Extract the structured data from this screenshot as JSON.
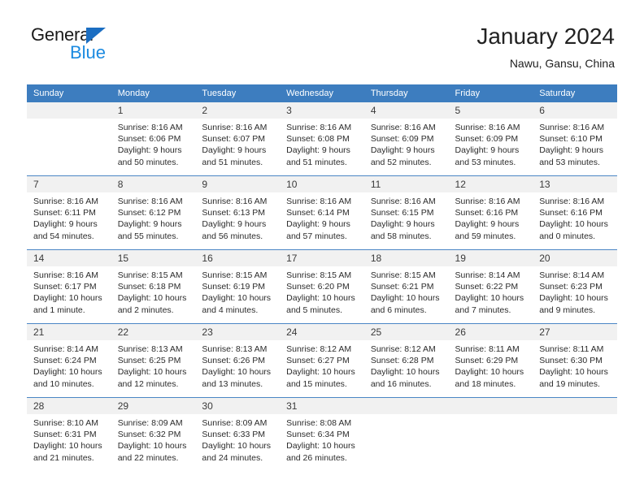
{
  "brand": {
    "name_top": "General",
    "name_bottom": "Blue",
    "accent_color": "#1b8ae0",
    "triangle_color": "#1b6ec2"
  },
  "header": {
    "title": "January 2024",
    "subtitle": "Nawu, Gansu, China"
  },
  "theme": {
    "header_bg": "#3d7dbf",
    "daynum_bg": "#f1f1f1",
    "grid_line": "#4a86c5"
  },
  "weekday_headers": [
    "Sunday",
    "Monday",
    "Tuesday",
    "Wednesday",
    "Thursday",
    "Friday",
    "Saturday"
  ],
  "weeks": [
    [
      {
        "day": "",
        "sunrise": "",
        "sunset": "",
        "daylight1": "",
        "daylight2": "",
        "empty": true
      },
      {
        "day": "1",
        "sunrise": "Sunrise: 8:16 AM",
        "sunset": "Sunset: 6:06 PM",
        "daylight1": "Daylight: 9 hours",
        "daylight2": "and 50 minutes."
      },
      {
        "day": "2",
        "sunrise": "Sunrise: 8:16 AM",
        "sunset": "Sunset: 6:07 PM",
        "daylight1": "Daylight: 9 hours",
        "daylight2": "and 51 minutes."
      },
      {
        "day": "3",
        "sunrise": "Sunrise: 8:16 AM",
        "sunset": "Sunset: 6:08 PM",
        "daylight1": "Daylight: 9 hours",
        "daylight2": "and 51 minutes."
      },
      {
        "day": "4",
        "sunrise": "Sunrise: 8:16 AM",
        "sunset": "Sunset: 6:09 PM",
        "daylight1": "Daylight: 9 hours",
        "daylight2": "and 52 minutes."
      },
      {
        "day": "5",
        "sunrise": "Sunrise: 8:16 AM",
        "sunset": "Sunset: 6:09 PM",
        "daylight1": "Daylight: 9 hours",
        "daylight2": "and 53 minutes."
      },
      {
        "day": "6",
        "sunrise": "Sunrise: 8:16 AM",
        "sunset": "Sunset: 6:10 PM",
        "daylight1": "Daylight: 9 hours",
        "daylight2": "and 53 minutes."
      }
    ],
    [
      {
        "day": "7",
        "sunrise": "Sunrise: 8:16 AM",
        "sunset": "Sunset: 6:11 PM",
        "daylight1": "Daylight: 9 hours",
        "daylight2": "and 54 minutes."
      },
      {
        "day": "8",
        "sunrise": "Sunrise: 8:16 AM",
        "sunset": "Sunset: 6:12 PM",
        "daylight1": "Daylight: 9 hours",
        "daylight2": "and 55 minutes."
      },
      {
        "day": "9",
        "sunrise": "Sunrise: 8:16 AM",
        "sunset": "Sunset: 6:13 PM",
        "daylight1": "Daylight: 9 hours",
        "daylight2": "and 56 minutes."
      },
      {
        "day": "10",
        "sunrise": "Sunrise: 8:16 AM",
        "sunset": "Sunset: 6:14 PM",
        "daylight1": "Daylight: 9 hours",
        "daylight2": "and 57 minutes."
      },
      {
        "day": "11",
        "sunrise": "Sunrise: 8:16 AM",
        "sunset": "Sunset: 6:15 PM",
        "daylight1": "Daylight: 9 hours",
        "daylight2": "and 58 minutes."
      },
      {
        "day": "12",
        "sunrise": "Sunrise: 8:16 AM",
        "sunset": "Sunset: 6:16 PM",
        "daylight1": "Daylight: 9 hours",
        "daylight2": "and 59 minutes."
      },
      {
        "day": "13",
        "sunrise": "Sunrise: 8:16 AM",
        "sunset": "Sunset: 6:16 PM",
        "daylight1": "Daylight: 10 hours",
        "daylight2": "and 0 minutes."
      }
    ],
    [
      {
        "day": "14",
        "sunrise": "Sunrise: 8:16 AM",
        "sunset": "Sunset: 6:17 PM",
        "daylight1": "Daylight: 10 hours",
        "daylight2": "and 1 minute."
      },
      {
        "day": "15",
        "sunrise": "Sunrise: 8:15 AM",
        "sunset": "Sunset: 6:18 PM",
        "daylight1": "Daylight: 10 hours",
        "daylight2": "and 2 minutes."
      },
      {
        "day": "16",
        "sunrise": "Sunrise: 8:15 AM",
        "sunset": "Sunset: 6:19 PM",
        "daylight1": "Daylight: 10 hours",
        "daylight2": "and 4 minutes."
      },
      {
        "day": "17",
        "sunrise": "Sunrise: 8:15 AM",
        "sunset": "Sunset: 6:20 PM",
        "daylight1": "Daylight: 10 hours",
        "daylight2": "and 5 minutes."
      },
      {
        "day": "18",
        "sunrise": "Sunrise: 8:15 AM",
        "sunset": "Sunset: 6:21 PM",
        "daylight1": "Daylight: 10 hours",
        "daylight2": "and 6 minutes."
      },
      {
        "day": "19",
        "sunrise": "Sunrise: 8:14 AM",
        "sunset": "Sunset: 6:22 PM",
        "daylight1": "Daylight: 10 hours",
        "daylight2": "and 7 minutes."
      },
      {
        "day": "20",
        "sunrise": "Sunrise: 8:14 AM",
        "sunset": "Sunset: 6:23 PM",
        "daylight1": "Daylight: 10 hours",
        "daylight2": "and 9 minutes."
      }
    ],
    [
      {
        "day": "21",
        "sunrise": "Sunrise: 8:14 AM",
        "sunset": "Sunset: 6:24 PM",
        "daylight1": "Daylight: 10 hours",
        "daylight2": "and 10 minutes."
      },
      {
        "day": "22",
        "sunrise": "Sunrise: 8:13 AM",
        "sunset": "Sunset: 6:25 PM",
        "daylight1": "Daylight: 10 hours",
        "daylight2": "and 12 minutes."
      },
      {
        "day": "23",
        "sunrise": "Sunrise: 8:13 AM",
        "sunset": "Sunset: 6:26 PM",
        "daylight1": "Daylight: 10 hours",
        "daylight2": "and 13 minutes."
      },
      {
        "day": "24",
        "sunrise": "Sunrise: 8:12 AM",
        "sunset": "Sunset: 6:27 PM",
        "daylight1": "Daylight: 10 hours",
        "daylight2": "and 15 minutes."
      },
      {
        "day": "25",
        "sunrise": "Sunrise: 8:12 AM",
        "sunset": "Sunset: 6:28 PM",
        "daylight1": "Daylight: 10 hours",
        "daylight2": "and 16 minutes."
      },
      {
        "day": "26",
        "sunrise": "Sunrise: 8:11 AM",
        "sunset": "Sunset: 6:29 PM",
        "daylight1": "Daylight: 10 hours",
        "daylight2": "and 18 minutes."
      },
      {
        "day": "27",
        "sunrise": "Sunrise: 8:11 AM",
        "sunset": "Sunset: 6:30 PM",
        "daylight1": "Daylight: 10 hours",
        "daylight2": "and 19 minutes."
      }
    ],
    [
      {
        "day": "28",
        "sunrise": "Sunrise: 8:10 AM",
        "sunset": "Sunset: 6:31 PM",
        "daylight1": "Daylight: 10 hours",
        "daylight2": "and 21 minutes."
      },
      {
        "day": "29",
        "sunrise": "Sunrise: 8:09 AM",
        "sunset": "Sunset: 6:32 PM",
        "daylight1": "Daylight: 10 hours",
        "daylight2": "and 22 minutes."
      },
      {
        "day": "30",
        "sunrise": "Sunrise: 8:09 AM",
        "sunset": "Sunset: 6:33 PM",
        "daylight1": "Daylight: 10 hours",
        "daylight2": "and 24 minutes."
      },
      {
        "day": "31",
        "sunrise": "Sunrise: 8:08 AM",
        "sunset": "Sunset: 6:34 PM",
        "daylight1": "Daylight: 10 hours",
        "daylight2": "and 26 minutes."
      },
      {
        "day": "",
        "sunrise": "",
        "sunset": "",
        "daylight1": "",
        "daylight2": "",
        "empty": true
      },
      {
        "day": "",
        "sunrise": "",
        "sunset": "",
        "daylight1": "",
        "daylight2": "",
        "empty": true
      },
      {
        "day": "",
        "sunrise": "",
        "sunset": "",
        "daylight1": "",
        "daylight2": "",
        "empty": true
      }
    ]
  ]
}
